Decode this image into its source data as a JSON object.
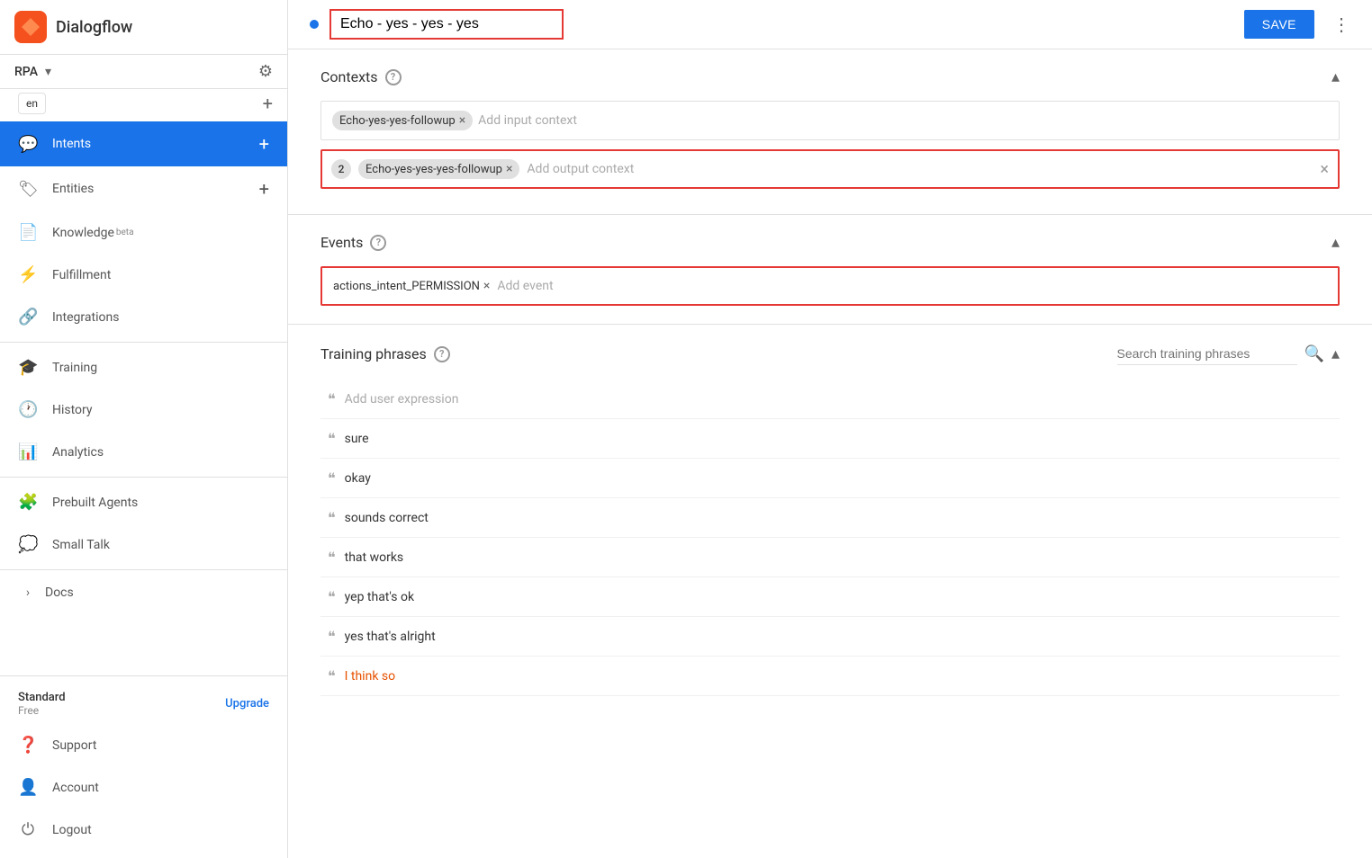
{
  "sidebar": {
    "logo_text": "Dialogflow",
    "agent_name": "RPA",
    "lang": "en",
    "nav_items": [
      {
        "id": "intents",
        "label": "Intents",
        "icon": "💬",
        "active": true,
        "has_plus": true
      },
      {
        "id": "entities",
        "label": "Entities",
        "icon": "🏷",
        "active": false,
        "has_plus": true
      },
      {
        "id": "knowledge",
        "label": "Knowledge",
        "icon": "📄",
        "active": false,
        "badge": "beta"
      },
      {
        "id": "fulfillment",
        "label": "Fulfillment",
        "icon": "⚡",
        "active": false
      },
      {
        "id": "integrations",
        "label": "Integrations",
        "icon": "🔗",
        "active": false
      },
      {
        "id": "divider1"
      },
      {
        "id": "training",
        "label": "Training",
        "icon": "🎓",
        "active": false
      },
      {
        "id": "history",
        "label": "History",
        "icon": "🕐",
        "active": false
      },
      {
        "id": "analytics",
        "label": "Analytics",
        "icon": "📊",
        "active": false
      },
      {
        "id": "divider2"
      },
      {
        "id": "prebuilt",
        "label": "Prebuilt Agents",
        "icon": "🧩",
        "active": false
      },
      {
        "id": "smalltalk",
        "label": "Small Talk",
        "icon": "💭",
        "active": false
      },
      {
        "id": "divider3"
      },
      {
        "id": "docs",
        "label": "Docs",
        "icon": "›",
        "active": false,
        "expand": true
      }
    ],
    "bottom": {
      "plan": "Standard",
      "sub": "Free",
      "upgrade": "Upgrade",
      "support": "Support",
      "account": "Account",
      "logout": "Logout"
    }
  },
  "header": {
    "intent_name": "Echo - yes - yes - yes",
    "save_label": "SAVE"
  },
  "contexts": {
    "title": "Contexts",
    "input_chip": "Echo-yes-yes-followup",
    "add_input_placeholder": "Add input context",
    "output_number": "2",
    "output_chip": "Echo-yes-yes-yes-followup",
    "add_output_placeholder": "Add output context"
  },
  "events": {
    "title": "Events",
    "event_chip": "actions_intent_PERMISSION",
    "add_event_placeholder": "Add event"
  },
  "training_phrases": {
    "title": "Training phrases",
    "search_placeholder": "Search training phrases",
    "add_expression_placeholder": "Add user expression",
    "phrases": [
      {
        "text": "sure",
        "highlight": false
      },
      {
        "text": "okay",
        "highlight": false
      },
      {
        "text": "sounds correct",
        "highlight": false
      },
      {
        "text": "that works",
        "highlight": false
      },
      {
        "text": "yep that's ok",
        "highlight": false
      },
      {
        "text": "yes that's alright",
        "highlight": false
      },
      {
        "text": "I think so",
        "highlight": true
      }
    ]
  },
  "icons": {
    "chevron_down": "▾",
    "chevron_up": "▴",
    "close": "×",
    "gear": "⚙",
    "plus": "+",
    "more_vert": "⋮",
    "help": "?",
    "search": "🔍",
    "quote": "❝"
  }
}
